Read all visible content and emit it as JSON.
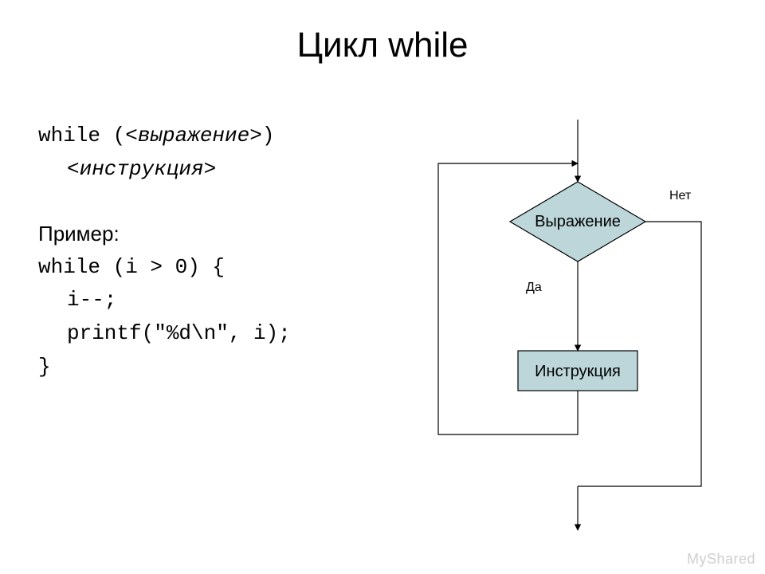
{
  "title": "Цикл while",
  "syntax": {
    "line1_a": "while (",
    "line1_b": "<выражение>",
    "line1_c": ")",
    "line2": "<инструкция>"
  },
  "example": {
    "heading": "Пример:",
    "l1": "while (i > 0) {",
    "l2": "i--;",
    "l3": "printf(\"%d\\n\", i);",
    "l4": "}"
  },
  "flow": {
    "condition": "Выражение",
    "body": "Инструкция",
    "yes": "Да",
    "no": "Нет"
  },
  "watermark": "MyShared",
  "chart_data": {
    "type": "flowchart",
    "title": "while loop",
    "nodes": [
      {
        "id": "entry",
        "kind": "start"
      },
      {
        "id": "cond",
        "kind": "decision",
        "label": "Выражение"
      },
      {
        "id": "body",
        "kind": "process",
        "label": "Инструкция"
      },
      {
        "id": "exit",
        "kind": "end"
      }
    ],
    "edges": [
      {
        "from": "entry",
        "to": "cond"
      },
      {
        "from": "cond",
        "to": "body",
        "label": "Да"
      },
      {
        "from": "body",
        "to": "cond"
      },
      {
        "from": "cond",
        "to": "exit",
        "label": "Нет"
      }
    ]
  }
}
